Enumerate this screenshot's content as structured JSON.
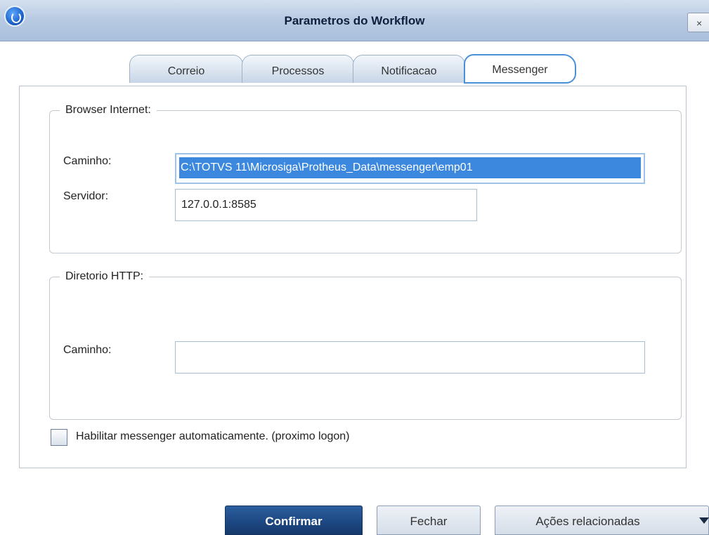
{
  "window": {
    "title": "Parametros do Workflow",
    "close_label": "×"
  },
  "tabs": [
    {
      "label": "Correio",
      "active": false
    },
    {
      "label": "Processos",
      "active": false
    },
    {
      "label": "Notificacao",
      "active": false
    },
    {
      "label": "Messenger",
      "active": true
    }
  ],
  "browser_group": {
    "legend": "Browser Internet:",
    "path_label": "Caminho:",
    "path_value": "C:\\TOTVS 11\\Microsiga\\Protheus_Data\\messenger\\emp01",
    "server_label": "Servidor:",
    "server_value": "127.0.0.1:8585"
  },
  "http_group": {
    "legend": "Diretorio HTTP:",
    "path_label": "Caminho:",
    "path_value": ""
  },
  "auto_enable": {
    "label": "Habilitar messenger automaticamente. (proximo logon)",
    "checked": false
  },
  "buttons": {
    "confirm": "Confirmar",
    "close": "Fechar",
    "related": "Ações relacionadas"
  },
  "colors": {
    "accent": "#3c88de",
    "primary_button": "#1c4680",
    "titlebar": "#b9cbe3"
  }
}
